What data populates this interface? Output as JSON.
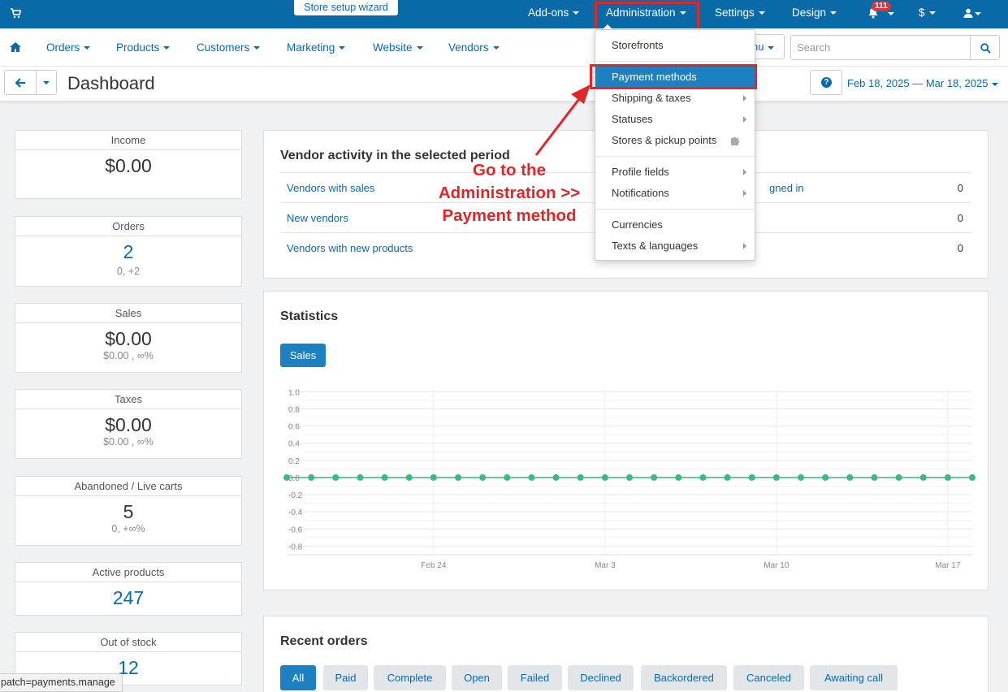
{
  "topbar": {
    "wizard_label": "Store setup wizard",
    "addons": "Add-ons",
    "administration": "Administration",
    "settings": "Settings",
    "design": "Design",
    "notifications_count": "111",
    "currency": "$"
  },
  "mainnav": {
    "items": [
      "Orders",
      "Products",
      "Customers",
      "Marketing",
      "Website",
      "Vendors"
    ],
    "menu_partial": "nu",
    "search_placeholder": "Search"
  },
  "header": {
    "title": "Dashboard",
    "date_range": "Feb 18, 2025 — Mar 18, 2025"
  },
  "stats": [
    {
      "label": "Income",
      "value": "$0.00",
      "sub": ""
    },
    {
      "label": "Orders",
      "value": "2",
      "sub": "0, +2"
    },
    {
      "label": "Sales",
      "value": "$0.00",
      "sub": "$0.00 , ∞%"
    },
    {
      "label": "Taxes",
      "value": "$0.00",
      "sub": "$0.00 , ∞%"
    },
    {
      "label": "Abandoned / Live carts",
      "value": "5",
      "sub": "0, +∞%"
    },
    {
      "label": "Active products",
      "value": "247",
      "sub": ""
    },
    {
      "label": "Out of stock",
      "value": "12",
      "sub": ""
    }
  ],
  "vendor_activity": {
    "title": "Vendor activity in the selected period",
    "rows": [
      {
        "label": "Vendors with sales",
        "mid": "gned in",
        "value": "0"
      },
      {
        "label": "New vendors",
        "mid": "",
        "value": "0"
      },
      {
        "label": "Vendors with new products",
        "mid": "",
        "value": "0"
      }
    ]
  },
  "statistics": {
    "title": "Statistics",
    "tab": "Sales"
  },
  "chart_data": {
    "type": "line",
    "title": "",
    "xlabel": "",
    "ylabel": "",
    "x_tick_labels": [
      "Feb 24",
      "Mar 3",
      "Mar 10",
      "Mar 17"
    ],
    "y_tick_labels": [
      "1.0",
      "0.8",
      "0.6",
      "0.4",
      "0.2",
      "0.0",
      "-0.2",
      "-0.4",
      "-0.6",
      "-0.8"
    ],
    "ylim": [
      -0.9,
      1.05
    ],
    "grid": true,
    "series": [
      {
        "values": [
          0,
          0,
          0,
          0,
          0,
          0,
          0,
          0,
          0,
          0,
          0,
          0,
          0,
          0,
          0,
          0,
          0,
          0,
          0,
          0,
          0,
          0,
          0,
          0,
          0,
          0,
          0,
          0,
          0
        ],
        "color": "#3cb882"
      }
    ]
  },
  "recent_orders": {
    "title": "Recent orders",
    "filters": [
      "All",
      "Paid",
      "Complete",
      "Open",
      "Failed",
      "Declined",
      "Backordered",
      "Canceled",
      "Awaiting call"
    ]
  },
  "dropdown": {
    "items": [
      "Storefronts",
      "Payment methods",
      "Shipping & taxes",
      "Statuses",
      "Stores & pickup points",
      "Profile fields",
      "Notifications",
      "Currencies",
      "Texts & languages"
    ]
  },
  "annotation": {
    "line1": "Go to the",
    "line2": "Administration >>",
    "line3": "Payment method"
  },
  "statusbar": "patch=payments.manage",
  "colors": {
    "brand": "#0a6aa8",
    "accent": "#1d80c3",
    "highlight": "#e02727",
    "series": "#3cb882"
  }
}
